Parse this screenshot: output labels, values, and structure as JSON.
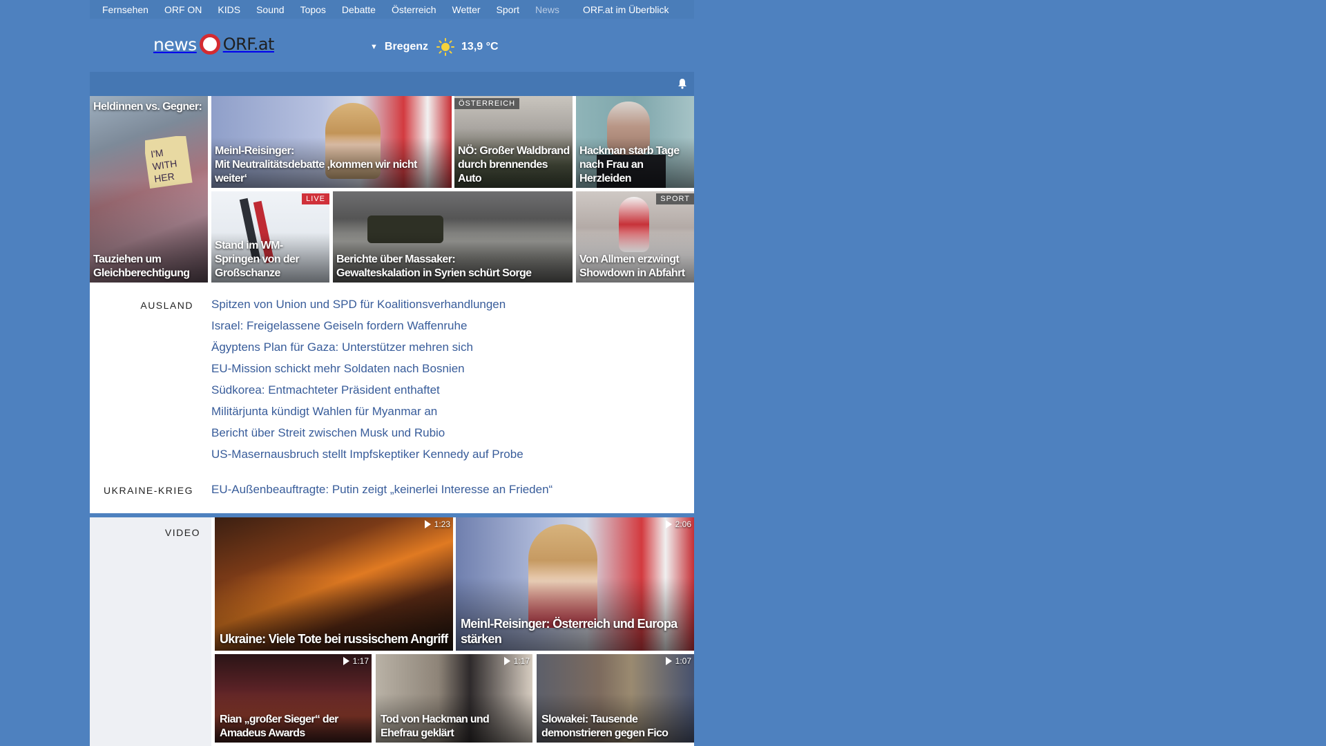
{
  "topnav": {
    "items": [
      "Fernsehen",
      "ORF ON",
      "KIDS",
      "Sound",
      "Topos",
      "Debatte",
      "Österreich",
      "Wetter",
      "Sport",
      "News"
    ],
    "overview": "ORF.at im Überblick"
  },
  "header": {
    "logo_news": "news",
    "logo_orf": "ORF.at",
    "weather_city": "Bregenz",
    "weather_temp": "13,9 °C",
    "weather_icon": "sun-icon"
  },
  "tiles": {
    "heldinnen": {
      "topcaption": "Heldinnen vs. Gegner:",
      "caption": "Tauziehen um Gleichberechtigung"
    },
    "meinl": {
      "caption_line1": "Meinl-Reisinger:",
      "caption_line2": "Mit Neutralitätsdebatte ‚kommen wir nicht weiter‘"
    },
    "waldbrand": {
      "label": "ÖSTERREICH",
      "caption": "NÖ: Großer Waldbrand durch brennendes Auto"
    },
    "hackman": {
      "caption": "Hackman starb Tage nach Frau an Herzleiden"
    },
    "springen": {
      "label": "LIVE",
      "caption": "Stand im WM-Springen von der Großschanze"
    },
    "syrien": {
      "caption_line1": "Berichte über Massaker:",
      "caption_line2": "Gewalteskalation in Syrien schürt Sorge"
    },
    "allmen": {
      "label": "SPORT",
      "caption": "Von Allmen erzwingt Showdown in Abfahrt"
    }
  },
  "sections": {
    "ausland": {
      "label": "AUSLAND",
      "items": [
        "Spitzen von Union und SPD für Koalitionsverhandlungen",
        "Israel: Freigelassene Geiseln fordern Waffenruhe",
        "Ägyptens Plan für Gaza: Unterstützer mehren sich",
        "EU-Mission schickt mehr Soldaten nach Bosnien",
        "Südkorea: Entmachteter Präsident enthaftet",
        "Militärjunta kündigt Wahlen für Myanmar an",
        "Bericht über Streit zwischen Musk und Rubio",
        "US-Masernausbruch stellt Impfskeptiker Kennedy auf Probe"
      ]
    },
    "ukraine": {
      "label": "UKRAINE-KRIEG",
      "items": [
        "EU-Außenbeauftragte: Putin zeigt „keinerlei Interesse an Frieden“"
      ]
    }
  },
  "video": {
    "label": "VIDEO",
    "items": [
      {
        "duration": "1:23",
        "caption": "Ukraine: Viele Tote bei russischem Angriff"
      },
      {
        "duration": "2:06",
        "caption": "Meinl-Reisinger: Österreich und Europa stärken"
      },
      {
        "duration": "1:17",
        "caption": "Rian „großer Sieger“ der Amadeus Awards"
      },
      {
        "duration": "1:17",
        "caption": "Tod von Hackman und Ehefrau geklärt"
      },
      {
        "duration": "1:07",
        "caption": "Slowakei: Tausende demonstrieren gegen Fico"
      }
    ]
  },
  "colors": {
    "page_bg": "#4e81bf",
    "headline_link": "#385c9a",
    "live_badge": "#d0313a",
    "logo_red": "#d42b31"
  }
}
